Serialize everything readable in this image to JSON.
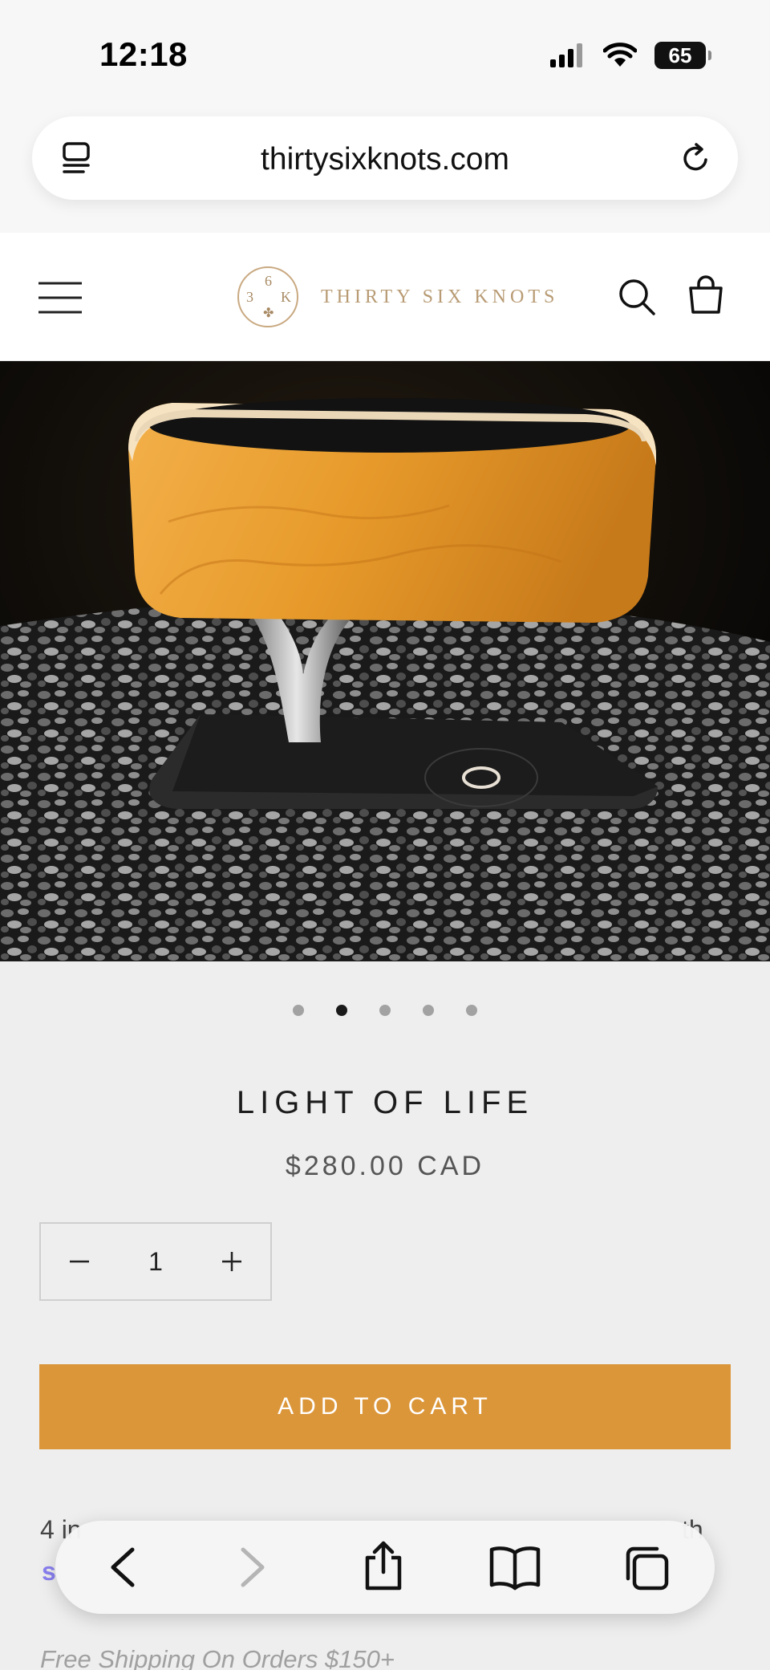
{
  "status": {
    "time": "12:18",
    "battery": "65"
  },
  "browser": {
    "url": "thirtysixknots.com"
  },
  "header": {
    "logo_numbers": [
      "6",
      "3",
      "K"
    ],
    "brand_name": "THIRTY SIX KNOTS"
  },
  "product": {
    "title": "LIGHT OF LIFE",
    "price": "$280.00 CAD",
    "quantity": "1",
    "add_to_cart": "ADD TO CART",
    "installments_text": "4 in",
    "installments_tail": "th",
    "shop_pay_fragment": "s",
    "shipping_note": "Free Shipping On Orders $150+",
    "image_count": 5,
    "active_image_index": 1
  },
  "colors": {
    "accent": "#db963a",
    "brand_gold": "#b89b74",
    "page_bg": "#eeeeee"
  },
  "icons": {
    "header": [
      "menu-icon",
      "search-icon",
      "shopping-bag-icon"
    ],
    "browser": [
      "tab-overview-icon",
      "reload-icon",
      "back-icon",
      "forward-icon",
      "share-icon",
      "bookmarks-icon",
      "tabs-icon"
    ]
  }
}
